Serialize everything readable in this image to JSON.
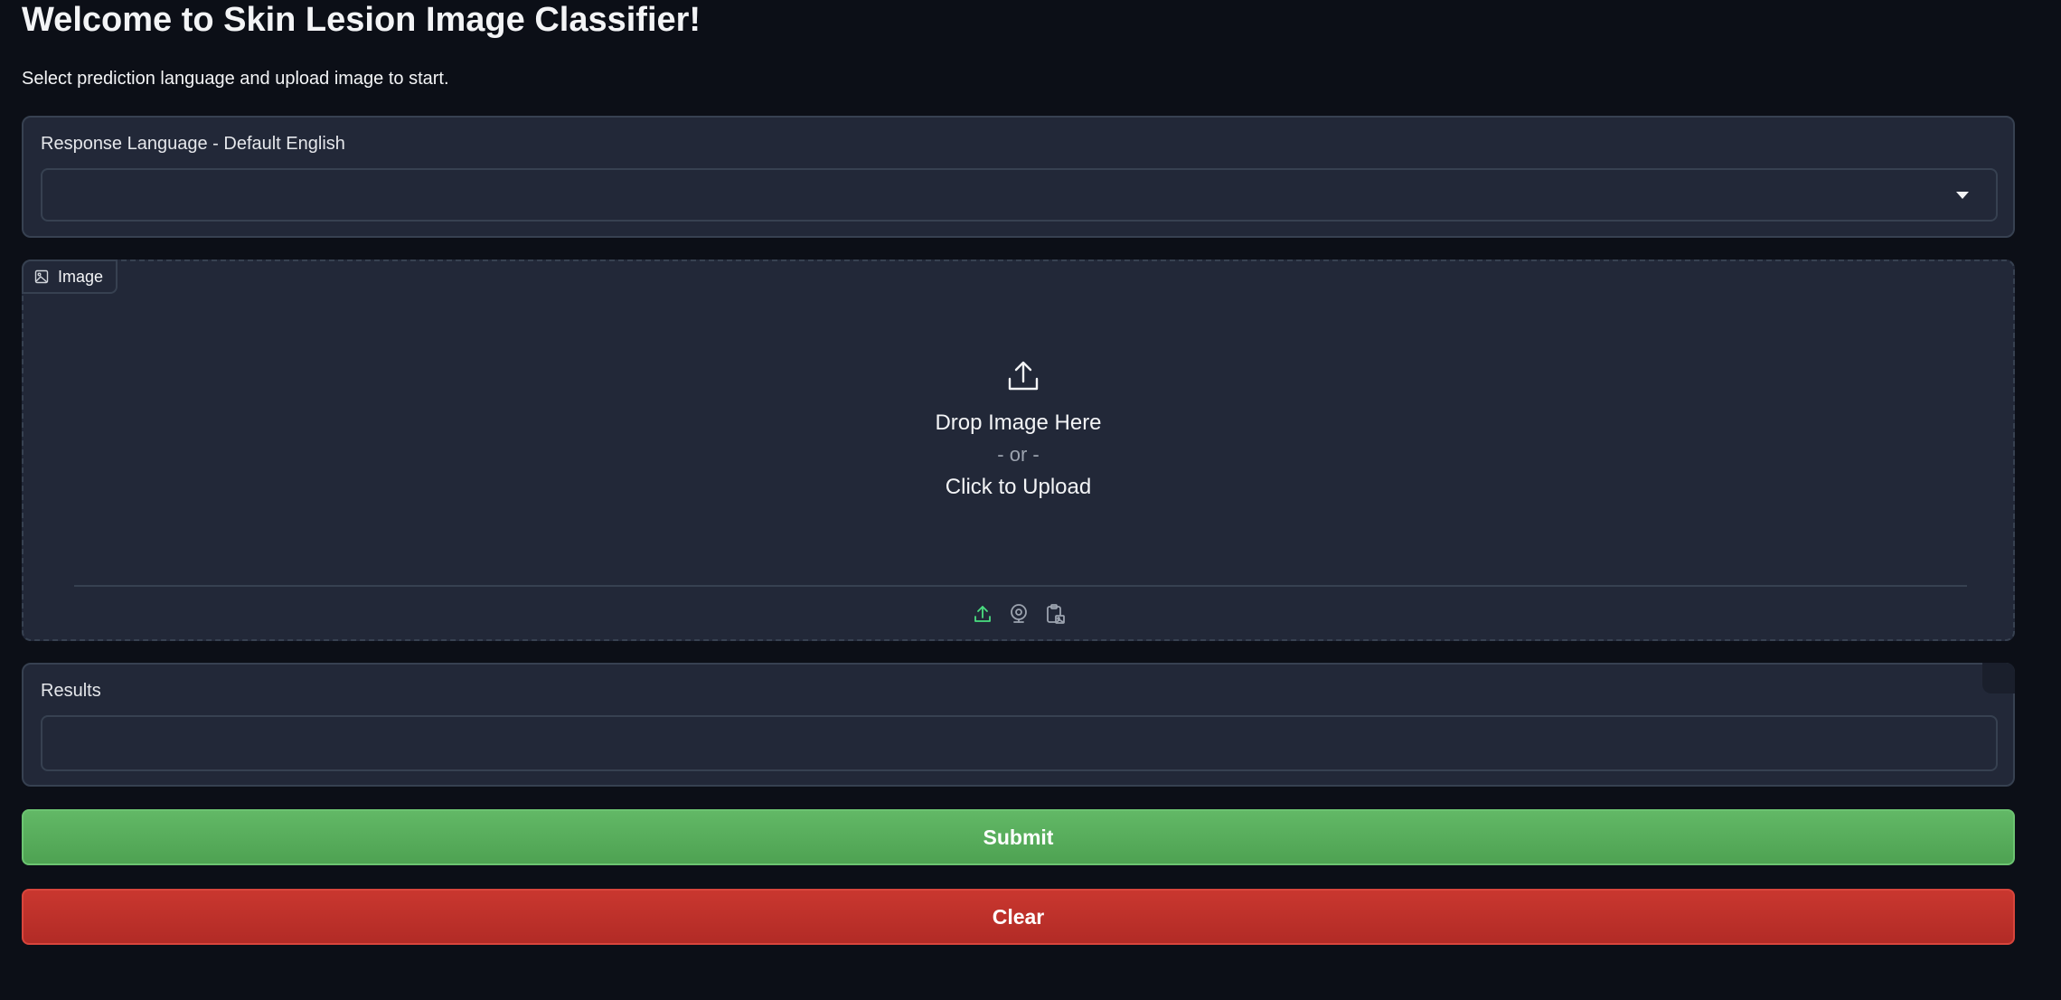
{
  "header": {
    "title": "Welcome to Skin Lesion Image Classifier!",
    "subtitle": "Select prediction language and upload image to start."
  },
  "language": {
    "label": "Response Language - Default English",
    "selected": ""
  },
  "image_input": {
    "tag_label": "Image",
    "drop_text": "Drop Image Here",
    "or_text": "- or -",
    "click_text": "Click to Upload",
    "sources": [
      {
        "name": "upload-source",
        "icon": "upload-icon",
        "color": "#4ade80",
        "active": true
      },
      {
        "name": "webcam-source",
        "icon": "webcam-icon",
        "color": "#9ca3af",
        "active": false
      },
      {
        "name": "clipboard-source",
        "icon": "clipboard-icon",
        "color": "#9ca3af",
        "active": false
      }
    ]
  },
  "results": {
    "label": "Results",
    "value": ""
  },
  "actions": {
    "submit_label": "Submit",
    "clear_label": "Clear"
  },
  "colors": {
    "background": "#0c0f17",
    "panel": "#222838",
    "border": "#374151",
    "submit": "#5bb060",
    "clear": "#c0322c",
    "accent_green": "#4ade80"
  }
}
